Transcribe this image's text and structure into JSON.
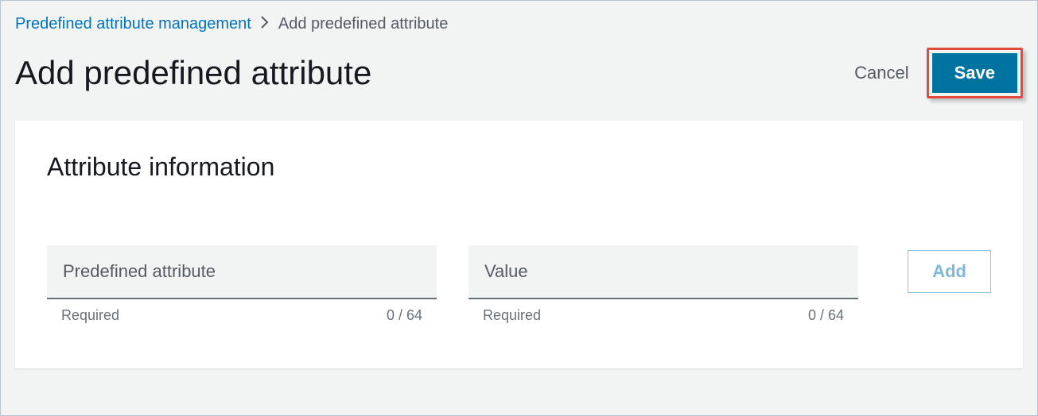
{
  "breadcrumb": {
    "parent": "Predefined attribute management",
    "current": "Add predefined attribute"
  },
  "page_title": "Add predefined attribute",
  "actions": {
    "cancel": "Cancel",
    "save": "Save"
  },
  "panel": {
    "title": "Attribute information",
    "fields": {
      "attribute": {
        "placeholder": "Predefined attribute",
        "required_label": "Required",
        "counter": "0 / 64"
      },
      "value": {
        "placeholder": "Value",
        "required_label": "Required",
        "counter": "0 / 64"
      }
    },
    "add_button": "Add"
  }
}
